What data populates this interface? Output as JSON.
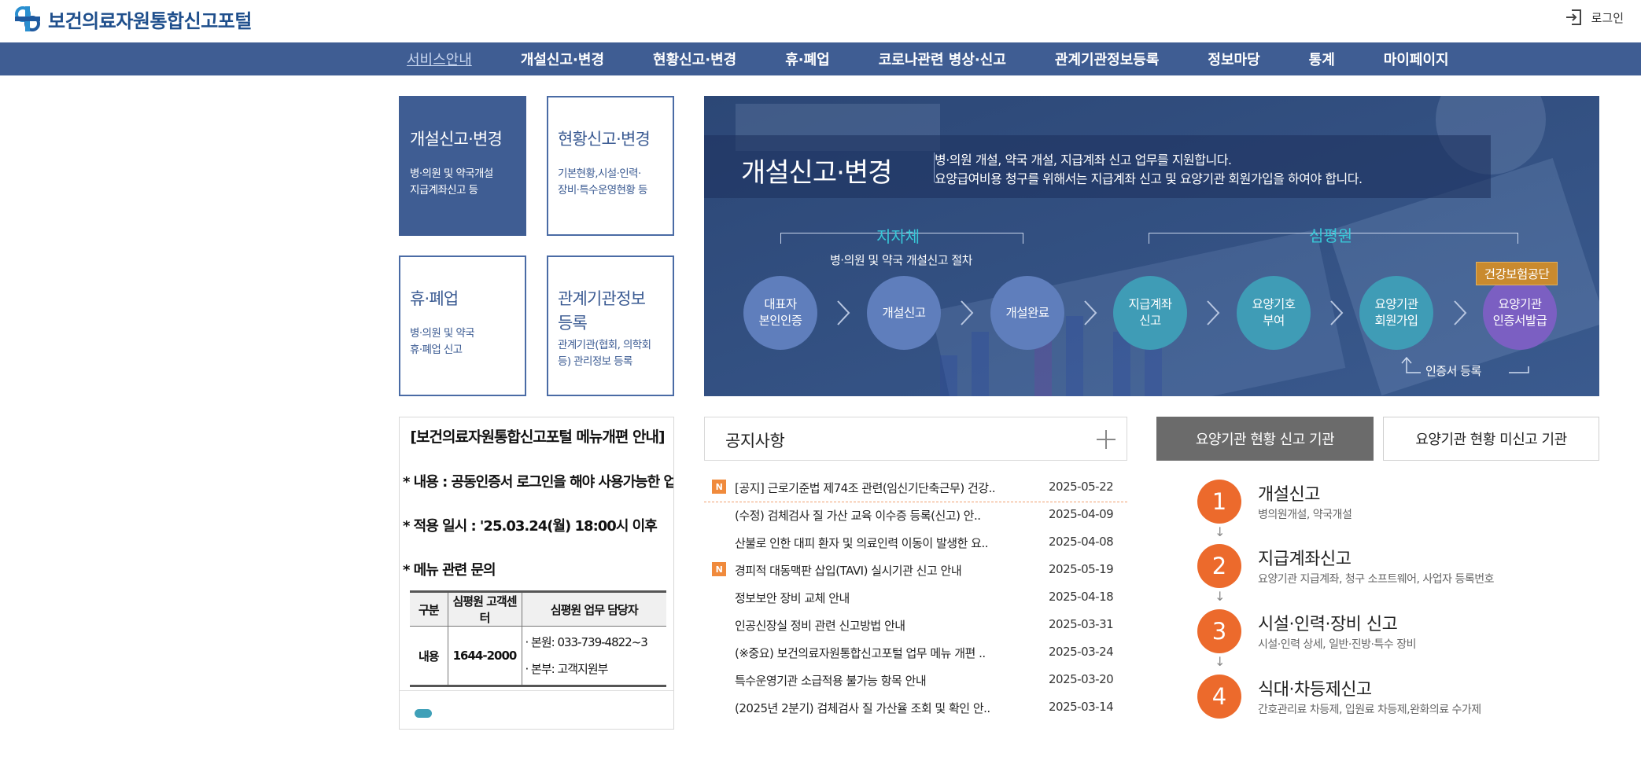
{
  "header": {
    "logo_text": "보건의료자원통합신고포털",
    "login_label": "로그인"
  },
  "nav": {
    "items": [
      {
        "label": "서비스안내",
        "active": true
      },
      {
        "label": "개설신고·변경"
      },
      {
        "label": "현황신고·변경"
      },
      {
        "label": "휴·폐업"
      },
      {
        "label": "코로나관련 병상·신고"
      },
      {
        "label": "관계기관정보등록"
      },
      {
        "label": "정보마당"
      },
      {
        "label": "통계"
      },
      {
        "label": "마이페이지"
      }
    ]
  },
  "quick_boxes": [
    {
      "title": "개설신고·변경",
      "desc1": "병·의원 및 약국개설",
      "desc2": "지급계좌신고 등"
    },
    {
      "title": "현황신고·변경",
      "desc1": "기본현황,시설·인력·",
      "desc2": "장비·특수운영현황 등"
    },
    {
      "title": "휴·폐업",
      "desc1": "병·의원 및 약국",
      "desc2": "휴·폐업 신고"
    },
    {
      "title1": "관계기관정보",
      "title2": "등록",
      "desc1": "관계기관(협회, 의학회",
      "desc2": "등) 관리정보 등록"
    }
  ],
  "banner": {
    "title": "개설신고·변경",
    "desc1": "병·의원 개설, 약국 개설, 지급계좌 신고 업무를 지원합니다.",
    "desc2": "요양급여비용 청구를 위해서는 지급계좌 신고 및 요양기관 회원가입을 하여야 합니다.",
    "group1_label": "지자체",
    "group1_sub": "병·의원 및 약국 개설신고 절차",
    "group2_label": "심평원",
    "nhis_label": "건강보험공단",
    "cert_label": "인증서 등록",
    "steps": [
      {
        "l1": "대표자",
        "l2": "본인인증"
      },
      {
        "l1": "개설신고",
        "l2": ""
      },
      {
        "l1": "개설완료",
        "l2": ""
      },
      {
        "l1": "지급계좌",
        "l2": "신고"
      },
      {
        "l1": "요양기호",
        "l2": "부여"
      },
      {
        "l1": "요양기관",
        "l2": "회원가입"
      },
      {
        "l1": "요양기관",
        "l2": "인증서발급"
      }
    ]
  },
  "notice_panel": {
    "title": "[보건의료자원통합신고포털 메뉴개편 안내]",
    "line1": "* 내용 : 공동인증서 로그인을 해야 사용가능한 업무 메뉴 표시",
    "line2": "* 적용 일시 : '25.03.24(월) 18:00시 이후",
    "line3": "* 메뉴 관련 문의",
    "table": {
      "headers": [
        "구분",
        "심평원 고객센터",
        "심평원 업무 담당자"
      ],
      "row_label": "내용",
      "center_phone": "1644-2000",
      "contact1": "· 본원: 033-739-4822~3",
      "contact2": "· 본부: 고객지원부"
    }
  },
  "notices": {
    "heading": "공지사항",
    "badge": "N",
    "items": [
      {
        "title": "[공지] 근로기준법 제74조 관련(임신기단축근무) 건강..",
        "date": "2025-05-22",
        "new": true
      },
      {
        "title": "(수정) 검체검사 질 가산 교육 이수증 등록(신고) 안..",
        "date": "2025-04-09",
        "new": false
      },
      {
        "title": "산불로 인한 대피 환자 및 의료인력 이동이 발생한 요..",
        "date": "2025-04-08",
        "new": false
      },
      {
        "title": "경피적 대동맥판 삽입(TAVI) 실시기관 신고 안내",
        "date": "2025-05-19",
        "new": true
      },
      {
        "title": "정보보안 장비 교체 안내",
        "date": "2025-04-18",
        "new": false
      },
      {
        "title": "인공신장실 정비 관련 신고방법 안내",
        "date": "2025-03-31",
        "new": false
      },
      {
        "title": "(※중요) 보건의료자원통합신고포털 업무 메뉴 개편 ..",
        "date": "2025-03-24",
        "new": false
      },
      {
        "title": "특수운영기관 소급적용 불가능 항목 안내",
        "date": "2025-03-20",
        "new": false
      },
      {
        "title": "(2025년 2분기) 검체검사 질 가산율 조회 및 확인 안..",
        "date": "2025-03-14",
        "new": false
      }
    ]
  },
  "right_tabs": {
    "active": "요양기관 현황 신고 기관",
    "inactive": "요양기관 현황 미신고 기관"
  },
  "process": [
    {
      "num": "1",
      "title": "개설신고",
      "desc": "병의원개설, 약국개설"
    },
    {
      "num": "2",
      "title": "지급계좌신고",
      "desc": "요양기관 지급계좌, 청구 소프트웨어, 사업자 등록번호"
    },
    {
      "num": "3",
      "title": "시설·인력·장비 신고",
      "desc": "시설·인력 상세, 일반·진방·특수 장비"
    },
    {
      "num": "4",
      "title": "식대·차등제신고",
      "desc": "간호관리료 차등제, 입원료 차등제,완화의료 수가제"
    }
  ],
  "process_arrow": "↓",
  "colors": {
    "nav_bg": "#3f5d93",
    "accent_orange": "#ec6a2c",
    "teal": "#3f9cb6"
  }
}
